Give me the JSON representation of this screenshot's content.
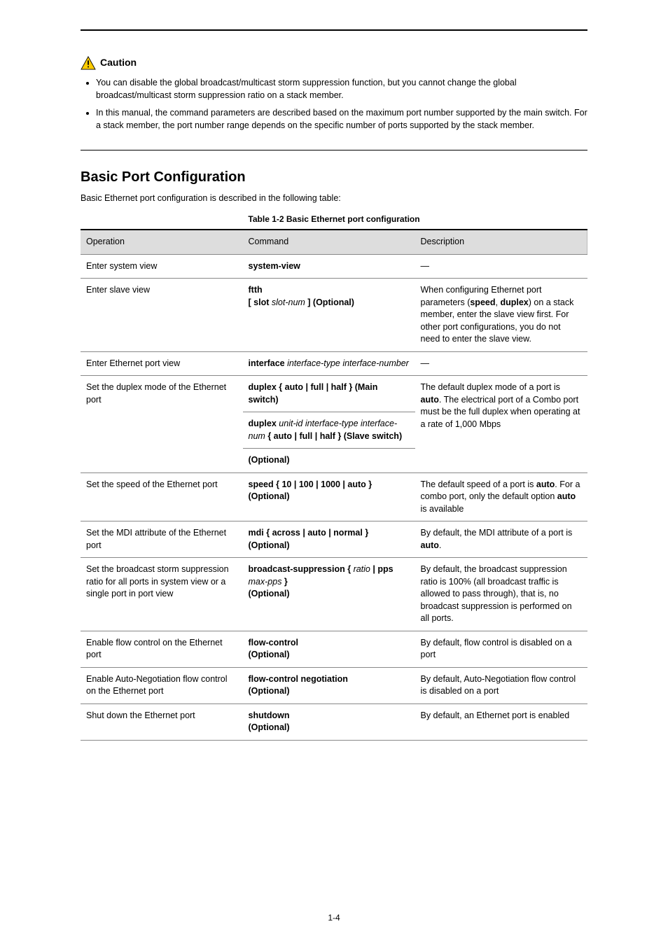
{
  "caution": {
    "label": "Caution",
    "items": [
      "You can disable the global broadcast/multicast storm suppression function, but you cannot change the global broadcast/multicast storm suppression ratio on a stack member.",
      "In this manual, the command parameters are described based on the maximum port number supported by the main switch. For a stack member, the port number range depends on the specific number of ports supported by the stack member."
    ]
  },
  "section": {
    "title": "Basic Port Configuration",
    "desc": "Basic Ethernet port configuration is described in the following table:",
    "table_title": "Table 1-2 Basic Ethernet port configuration"
  },
  "table": {
    "headers": [
      "Operation",
      "Command",
      "Description"
    ],
    "rows": [
      {
        "op": "Enter system view",
        "cmd_html": "system-view",
        "desc": "—",
        "rowspan": 1
      },
      {
        "op": "Enter slave view",
        "cmd_html": "<span class=\"kw-opt\">ftth</span><br>[ <span class=\"kw-opt\">slot</span> <span class=\"arg\">slot-num</span> ] (Optional)",
        "desc": "When configuring Ethernet port parameters (<b>speed</b>, <b>duplex</b>) on a stack member, enter the slave view first. For other port configurations, you do not need to enter the slave view.",
        "rowspan": 1
      },
      {
        "op": "Enter Ethernet port view",
        "cmd_html": "<span class=\"kw-opt\">interface</span> <span class=\"arg\">interface-type interface-number</span>",
        "desc": "—",
        "rowspan": 1
      },
      {
        "op": "Set the duplex mode of the Ethernet port",
        "cmd_rows": [
          "<span class=\"kw-opt\">duplex</span> { <span class=\"kw-opt\">auto</span> | <span class=\"kw-opt\">full</span> | <span class=\"kw-opt\">half</span> } (Main switch)",
          "<span class=\"kw-opt\">duplex</span> <span class=\"arg\">unit-id interface-type interface-num</span> { <span class=\"kw-opt\">auto</span> | <span class=\"kw-opt\">full</span> | <span class=\"kw-opt\">half</span> } (Slave switch)",
          "(Optional)"
        ],
        "desc": "The default duplex mode of a port is <b>auto</b>. The electrical port of a Combo port must be the full duplex when operating at a rate of 1,000 Mbps",
        "rowspan": 3
      },
      {
        "op": "Set the speed of the Ethernet port",
        "cmd_html": "<span class=\"kw-opt\">speed</span> { <span class=\"kw-opt\">10</span> | <span class=\"kw-opt\">100</span> | <span class=\"kw-opt\">1000</span> | <span class=\"kw-opt\">auto</span> }<br>(Optional)",
        "desc": "The default speed of a port is <b>auto</b>. For a combo port, only the default option <b>auto</b> is available",
        "rowspan": 1
      },
      {
        "op": "Set the MDI attribute of the Ethernet port",
        "cmd_html": "<span class=\"kw-opt\">mdi</span> { <span class=\"kw-opt\">across</span> | <span class=\"kw-opt\">auto</span> | <span class=\"kw-opt\">normal</span> }<br>(Optional)",
        "desc": "By default, the MDI attribute of a port is <b>auto</b>.",
        "rowspan": 1
      },
      {
        "op": "Set the broadcast storm suppression ratio for all ports in system view or a single port in port view",
        "cmd_html": "<span class=\"kw-opt\">broadcast-suppression</span> { <span class=\"arg\">ratio</span> | <span class=\"kw-opt\">pps</span> <span class=\"arg\">max-pps</span> }<br>(Optional)",
        "desc": "By default, the broadcast suppression ratio is 100% (all broadcast traffic is allowed to pass through), that is, no broadcast suppression is performed on all ports.",
        "rowspan": 1
      },
      {
        "op": "Enable flow control on the Ethernet port",
        "cmd_html": "<span class=\"kw-opt\">flow-control</span><br>(Optional)",
        "desc": "By default, flow control is disabled on a port",
        "rowspan": 1
      },
      {
        "op": "Enable Auto-Negotiation flow control on the Ethernet port",
        "cmd_html": "<span class=\"kw-opt\">flow-control negotiation</span><br>(Optional)",
        "desc": "By default, Auto-Negotiation flow control is disabled on a port",
        "rowspan": 1
      },
      {
        "op": "Shut down the Ethernet port",
        "cmd_html": "<span class=\"kw-opt\">shutdown</span><br>(Optional)",
        "desc": "By default, an Ethernet port is enabled",
        "rowspan": 1
      }
    ]
  },
  "page_number": "1-4"
}
